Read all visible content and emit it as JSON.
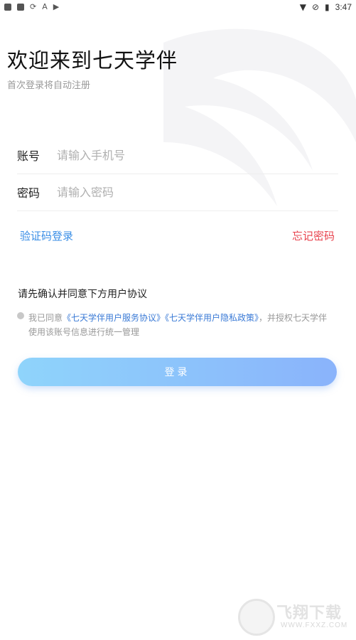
{
  "status_bar": {
    "time": "3:47",
    "icons": [
      "square-icon",
      "sync-icon",
      "font-icon",
      "play-icon",
      "wifi-icon",
      "no-sim-icon",
      "battery-icon"
    ]
  },
  "header": {
    "title": "欢迎来到七天学伴",
    "subtitle": "首次登录将自动注册"
  },
  "form": {
    "phone_label": "账号",
    "phone_placeholder": "请输入手机号",
    "password_label": "密码",
    "password_placeholder": "请输入密码",
    "code_login": "验证码登录",
    "forgot_password": "忘记密码"
  },
  "agreement": {
    "title": "请先确认并同意下方用户协议",
    "prefix": "我已同意",
    "service_link": "《七天学伴用户服务协议》",
    "privacy_link": "《七天学伴用户隐私政策》",
    "suffix": "，并授权七天学伴使用该账号信息进行统一管理"
  },
  "login_button": "登录",
  "watermark": {
    "text": "飞翔下载",
    "url": "WWW.FXXZ.COM"
  },
  "colors": {
    "link_blue": "#3a8ee6",
    "forgot_red": "#e8434e",
    "button_start": "#8fd4fb",
    "button_end": "#8ab3fb"
  }
}
